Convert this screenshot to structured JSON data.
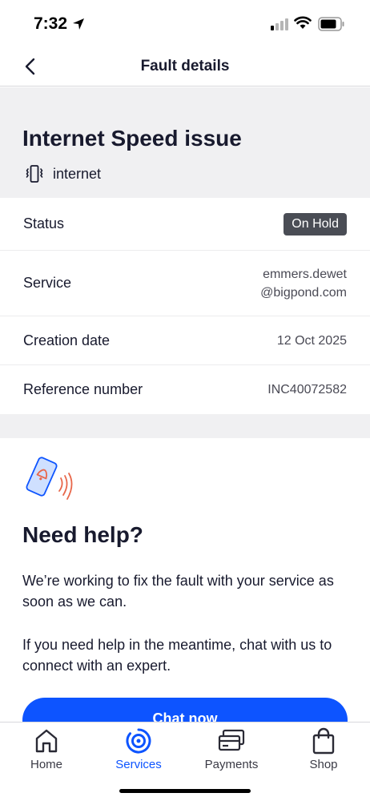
{
  "status_bar": {
    "time": "7:32"
  },
  "nav": {
    "title": "Fault details"
  },
  "fault": {
    "title": "Internet Speed issue",
    "type_label": "internet"
  },
  "details": {
    "status_label": "Status",
    "status_value": "On Hold",
    "service_label": "Service",
    "service_value_line1": "emmers.dewet",
    "service_value_line2": "@bigpond.com",
    "date_label": "Creation date",
    "date_value": "12 Oct 2025",
    "ref_label": "Reference number",
    "ref_value": "INC40072582"
  },
  "help": {
    "title": "Need help?",
    "text1": "We’re working to fix the fault with your service as soon as we can.",
    "text2": "If you need help in the meantime, chat with us to connect with an expert.",
    "chat_button": "Chat now"
  },
  "tabs": [
    {
      "label": "Home",
      "icon": "home-icon",
      "active": false
    },
    {
      "label": "Services",
      "icon": "services-icon",
      "active": true
    },
    {
      "label": "Payments",
      "icon": "payments-icon",
      "active": false
    },
    {
      "label": "Shop",
      "icon": "shop-icon",
      "active": false
    }
  ],
  "colors": {
    "accent": "#0d54ff",
    "status_badge": "#4a4d55",
    "band_gray": "#f0f0f2"
  }
}
